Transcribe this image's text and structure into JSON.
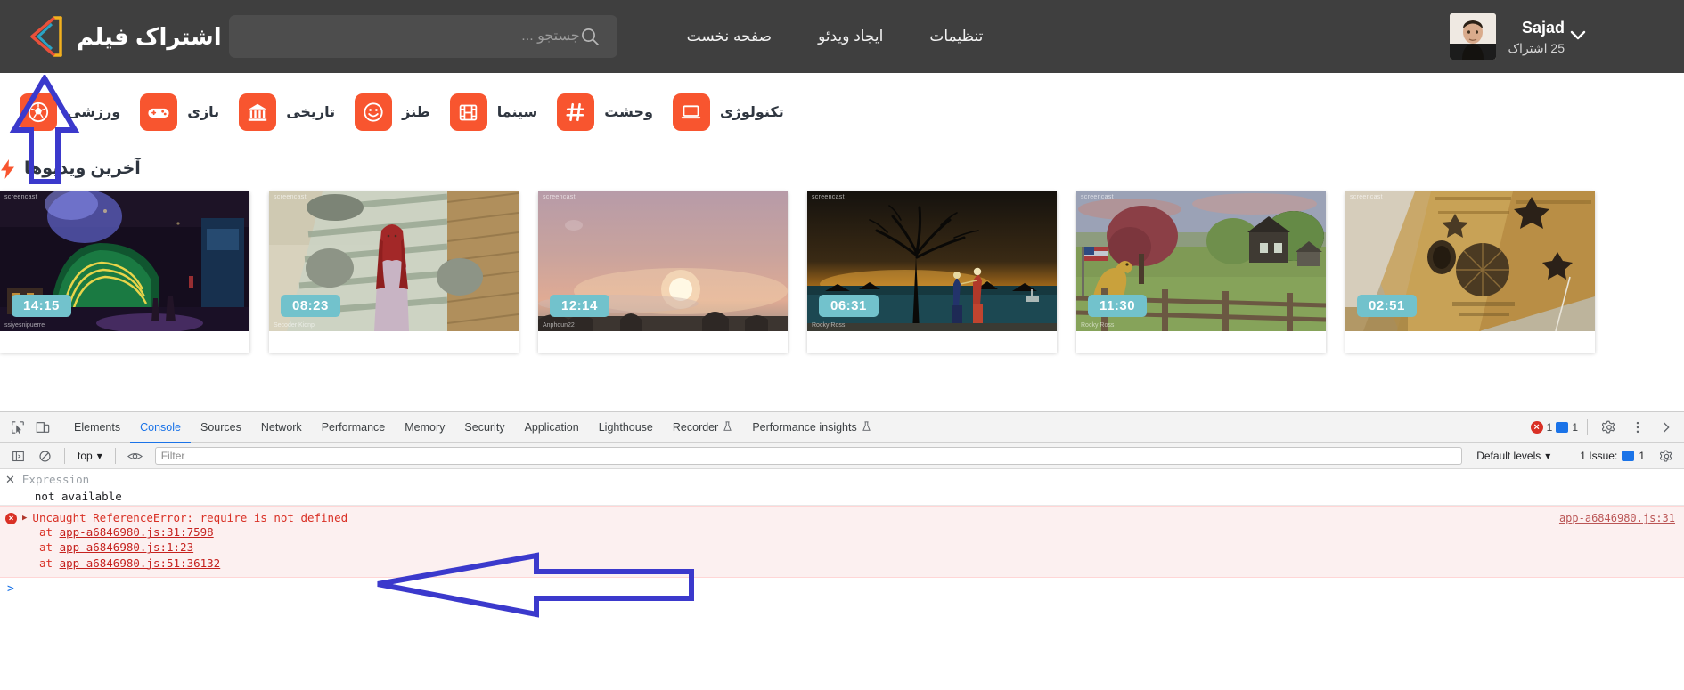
{
  "site": {
    "brand_name": "اشتراک فیلم",
    "logo_icon": "chevron-play-logo"
  },
  "search": {
    "placeholder": "جستجو ...",
    "value": "",
    "icon": "search-icon"
  },
  "nav": {
    "items": [
      {
        "label": "صفحه نخست",
        "name": "home"
      },
      {
        "label": "ایجاد ویدئو",
        "name": "create-video"
      },
      {
        "label": "تنظیمات",
        "name": "settings"
      }
    ]
  },
  "account": {
    "username": "Sajad",
    "subscriptions": "25 اشتراک",
    "caret_icon": "chevron-down-icon",
    "avatar_icon": "user-avatar"
  },
  "categories": [
    {
      "label": "ورزشی",
      "icon": "soccer-ball-icon",
      "color": "#f8552f"
    },
    {
      "label": "بازی",
      "icon": "gamepad-icon",
      "color": "#f8552f"
    },
    {
      "label": "تاریخی",
      "icon": "museum-bank-icon",
      "color": "#f8552f"
    },
    {
      "label": "طنز",
      "icon": "smiley-face-icon",
      "color": "#f8552f"
    },
    {
      "label": "سینما",
      "icon": "film-strip-icon",
      "color": "#f8552f"
    },
    {
      "label": "وحشت",
      "icon": "hashtag-icon",
      "color": "#f8552f"
    },
    {
      "label": "تکنولوژی",
      "icon": "laptop-icon",
      "color": "#f8552f"
    }
  ],
  "latest_section": {
    "title": "آخرین ویدیوها",
    "icon": "lightning-bolt-icon",
    "accent": "#f8552f"
  },
  "videos": [
    {
      "duration": "14:15",
      "watermark": "screencast",
      "credit": "ssiyesnipuerre",
      "scene": "train"
    },
    {
      "duration": "08:23",
      "watermark": "screencast",
      "credit": "Secoder Kidnp",
      "scene": "avatar-girl"
    },
    {
      "duration": "12:14",
      "watermark": "screencast",
      "credit": "Anphoun22",
      "scene": "sunset"
    },
    {
      "duration": "06:31",
      "watermark": "screencast",
      "credit": "Rocky Ross",
      "scene": "night-tree"
    },
    {
      "duration": "11:30",
      "watermark": "screencast",
      "credit": "Rocky Ross",
      "scene": "farm"
    },
    {
      "duration": "02:51",
      "watermark": "screencast",
      "credit": "",
      "scene": "mosque-ceiling"
    }
  ],
  "duration_badge_color": "#72c2cc",
  "devtools": {
    "tabs": [
      {
        "label": "Elements",
        "active": false
      },
      {
        "label": "Console",
        "active": true
      },
      {
        "label": "Sources",
        "active": false
      },
      {
        "label": "Network",
        "active": false
      },
      {
        "label": "Performance",
        "active": false
      },
      {
        "label": "Memory",
        "active": false
      },
      {
        "label": "Security",
        "active": false
      },
      {
        "label": "Application",
        "active": false
      },
      {
        "label": "Lighthouse",
        "active": false
      },
      {
        "label": "Recorder",
        "active": false,
        "beaker": true
      },
      {
        "label": "Performance insights",
        "active": false,
        "beaker": true
      }
    ],
    "error_count": "1",
    "message_count": "1",
    "context": "top",
    "filter_placeholder": "Filter",
    "filter_value": "",
    "levels_label": "Default levels",
    "issues_label": "1 Issue:",
    "issues_count": "1",
    "console": {
      "expression_label": "Expression",
      "expression_value": "not available",
      "error_title": "Uncaught ReferenceError: require is not defined",
      "error_source": "app-a6846980.js:31",
      "stack": [
        {
          "at": "at",
          "link": "app-a6846980.js:31:7598"
        },
        {
          "at": "at",
          "link": "app-a6846980.js:1:23"
        },
        {
          "at": "at",
          "link": "app-a6846980.js:51:36132"
        }
      ],
      "prompt_glyph": ">"
    }
  },
  "annotations": [
    {
      "name": "up-arrow-annotation",
      "shape": "arrow-up",
      "color": "#3b39cc"
    },
    {
      "name": "left-arrow-annotation",
      "shape": "arrow-left",
      "color": "#3b39cc"
    }
  ]
}
